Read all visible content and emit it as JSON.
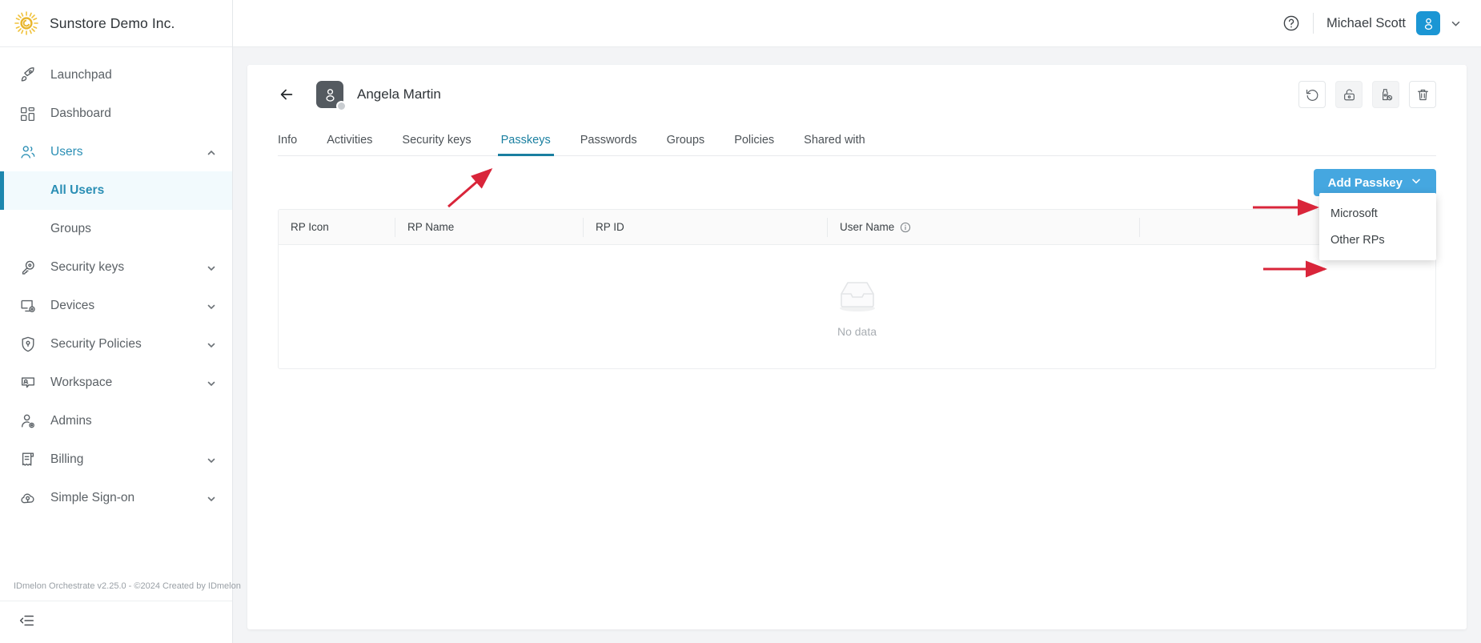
{
  "brand": {
    "name": "Sunstore Demo Inc.",
    "logo_icon": "sun-icon"
  },
  "sidebar": {
    "items": [
      {
        "label": "Launchpad",
        "icon": "rocket-icon",
        "expandable": false
      },
      {
        "label": "Dashboard",
        "icon": "dashboard-grid-icon",
        "expandable": false
      },
      {
        "label": "Users",
        "icon": "users-icon",
        "expandable": true,
        "expanded": true
      },
      {
        "label": "Security keys",
        "icon": "key-icon",
        "expandable": true
      },
      {
        "label": "Devices",
        "icon": "device-gear-icon",
        "expandable": true
      },
      {
        "label": "Security Policies",
        "icon": "shield-pin-icon",
        "expandable": true
      },
      {
        "label": "Workspace",
        "icon": "workspace-icon",
        "expandable": true
      },
      {
        "label": "Admins",
        "icon": "admin-gear-icon",
        "expandable": false
      },
      {
        "label": "Billing",
        "icon": "billing-receipt-icon",
        "expandable": true
      },
      {
        "label": "Simple Sign-on",
        "icon": "cloud-key-icon",
        "expandable": true
      }
    ],
    "sub_items": [
      {
        "label": "All Users",
        "active": true
      },
      {
        "label": "Groups",
        "active": false
      }
    ],
    "footer_text": "IDmelon Orchestrate v2.25.0 - ©2024 Created by IDmelon",
    "collapse_icon": "collapse-sidebar-icon"
  },
  "topbar": {
    "help_icon": "help-circle-icon",
    "user_name": "Michael Scott",
    "avatar_icon": "user-avatar-icon",
    "caret_icon": "chevron-down-icon"
  },
  "detail": {
    "back_icon": "arrow-left-icon",
    "avatar_icon": "user-avatar-icon",
    "entity_name": "Angela Martin",
    "actions": [
      {
        "name": "reset-button",
        "icon": "refresh-ccw-icon",
        "highlighted": false
      },
      {
        "name": "unlock-button",
        "icon": "unlock-icon",
        "highlighted": true
      },
      {
        "name": "revoke-key-button",
        "icon": "usb-key-revoke-icon",
        "highlighted": true
      },
      {
        "name": "delete-button",
        "icon": "trash-icon",
        "highlighted": false
      }
    ]
  },
  "tabs": [
    {
      "label": "Info",
      "active": false
    },
    {
      "label": "Activities",
      "active": false
    },
    {
      "label": "Security keys",
      "active": false
    },
    {
      "label": "Passkeys",
      "active": true
    },
    {
      "label": "Passwords",
      "active": false
    },
    {
      "label": "Groups",
      "active": false
    },
    {
      "label": "Policies",
      "active": false
    },
    {
      "label": "Shared with",
      "active": false
    }
  ],
  "toolbar": {
    "add_passkey_label": "Add Passkey",
    "add_passkey_caret_icon": "chevron-down-icon"
  },
  "dropdown": {
    "open": true,
    "items": [
      {
        "label": "Microsoft"
      },
      {
        "label": "Other RPs"
      }
    ]
  },
  "table": {
    "columns": [
      {
        "label": "RP Icon",
        "info_icon": false
      },
      {
        "label": "RP Name",
        "info_icon": false
      },
      {
        "label": "RP ID",
        "info_icon": false
      },
      {
        "label": "User Name",
        "info_icon": true
      },
      {
        "label": "",
        "info_icon": false
      }
    ],
    "rows": [],
    "empty_label": "No data",
    "empty_icon": "empty-box-icon"
  },
  "colors": {
    "primary_blue": "#45a7e0",
    "accent_teal": "#1a7fa0",
    "sidebar_active_bar": "#1d87ae",
    "sidebar_active_bg": "#f2fafd",
    "avatar_blue": "#1b96d4",
    "page_bg": "#f3f4f6",
    "annotation_red": "#d9253a"
  }
}
